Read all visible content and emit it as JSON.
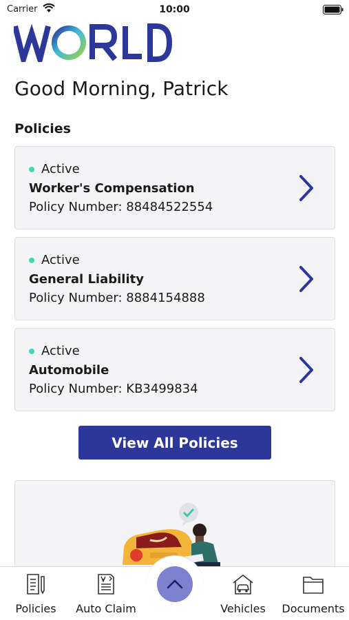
{
  "status_bar": {
    "carrier": "Carrier",
    "time": "10:00"
  },
  "brand": {
    "logo_text": "WORLD",
    "colors": {
      "primary": "#2d3799",
      "accent": "#3fd8b5"
    }
  },
  "greeting": "Good Morning, Patrick",
  "policies": {
    "title": "Policies",
    "items": [
      {
        "status": "Active",
        "type": "Worker's Compensation",
        "number": "Policy Number: 88484522554"
      },
      {
        "status": "Active",
        "type": "General Liability",
        "number": "Policy Number: 8884154888"
      },
      {
        "status": "Active",
        "type": "Automobile",
        "number": "Policy Number: KB3499834"
      }
    ],
    "view_all_label": "View All Policies"
  },
  "tabbar": {
    "items": [
      {
        "label": "Policies",
        "icon": "document-pen-icon"
      },
      {
        "label": "Auto Claim",
        "icon": "claim-form-icon"
      },
      {
        "label": "Vehicles",
        "icon": "car-garage-icon"
      },
      {
        "label": "Documents",
        "icon": "folder-icon"
      }
    ],
    "center_icon": "chevron-up-icon"
  }
}
